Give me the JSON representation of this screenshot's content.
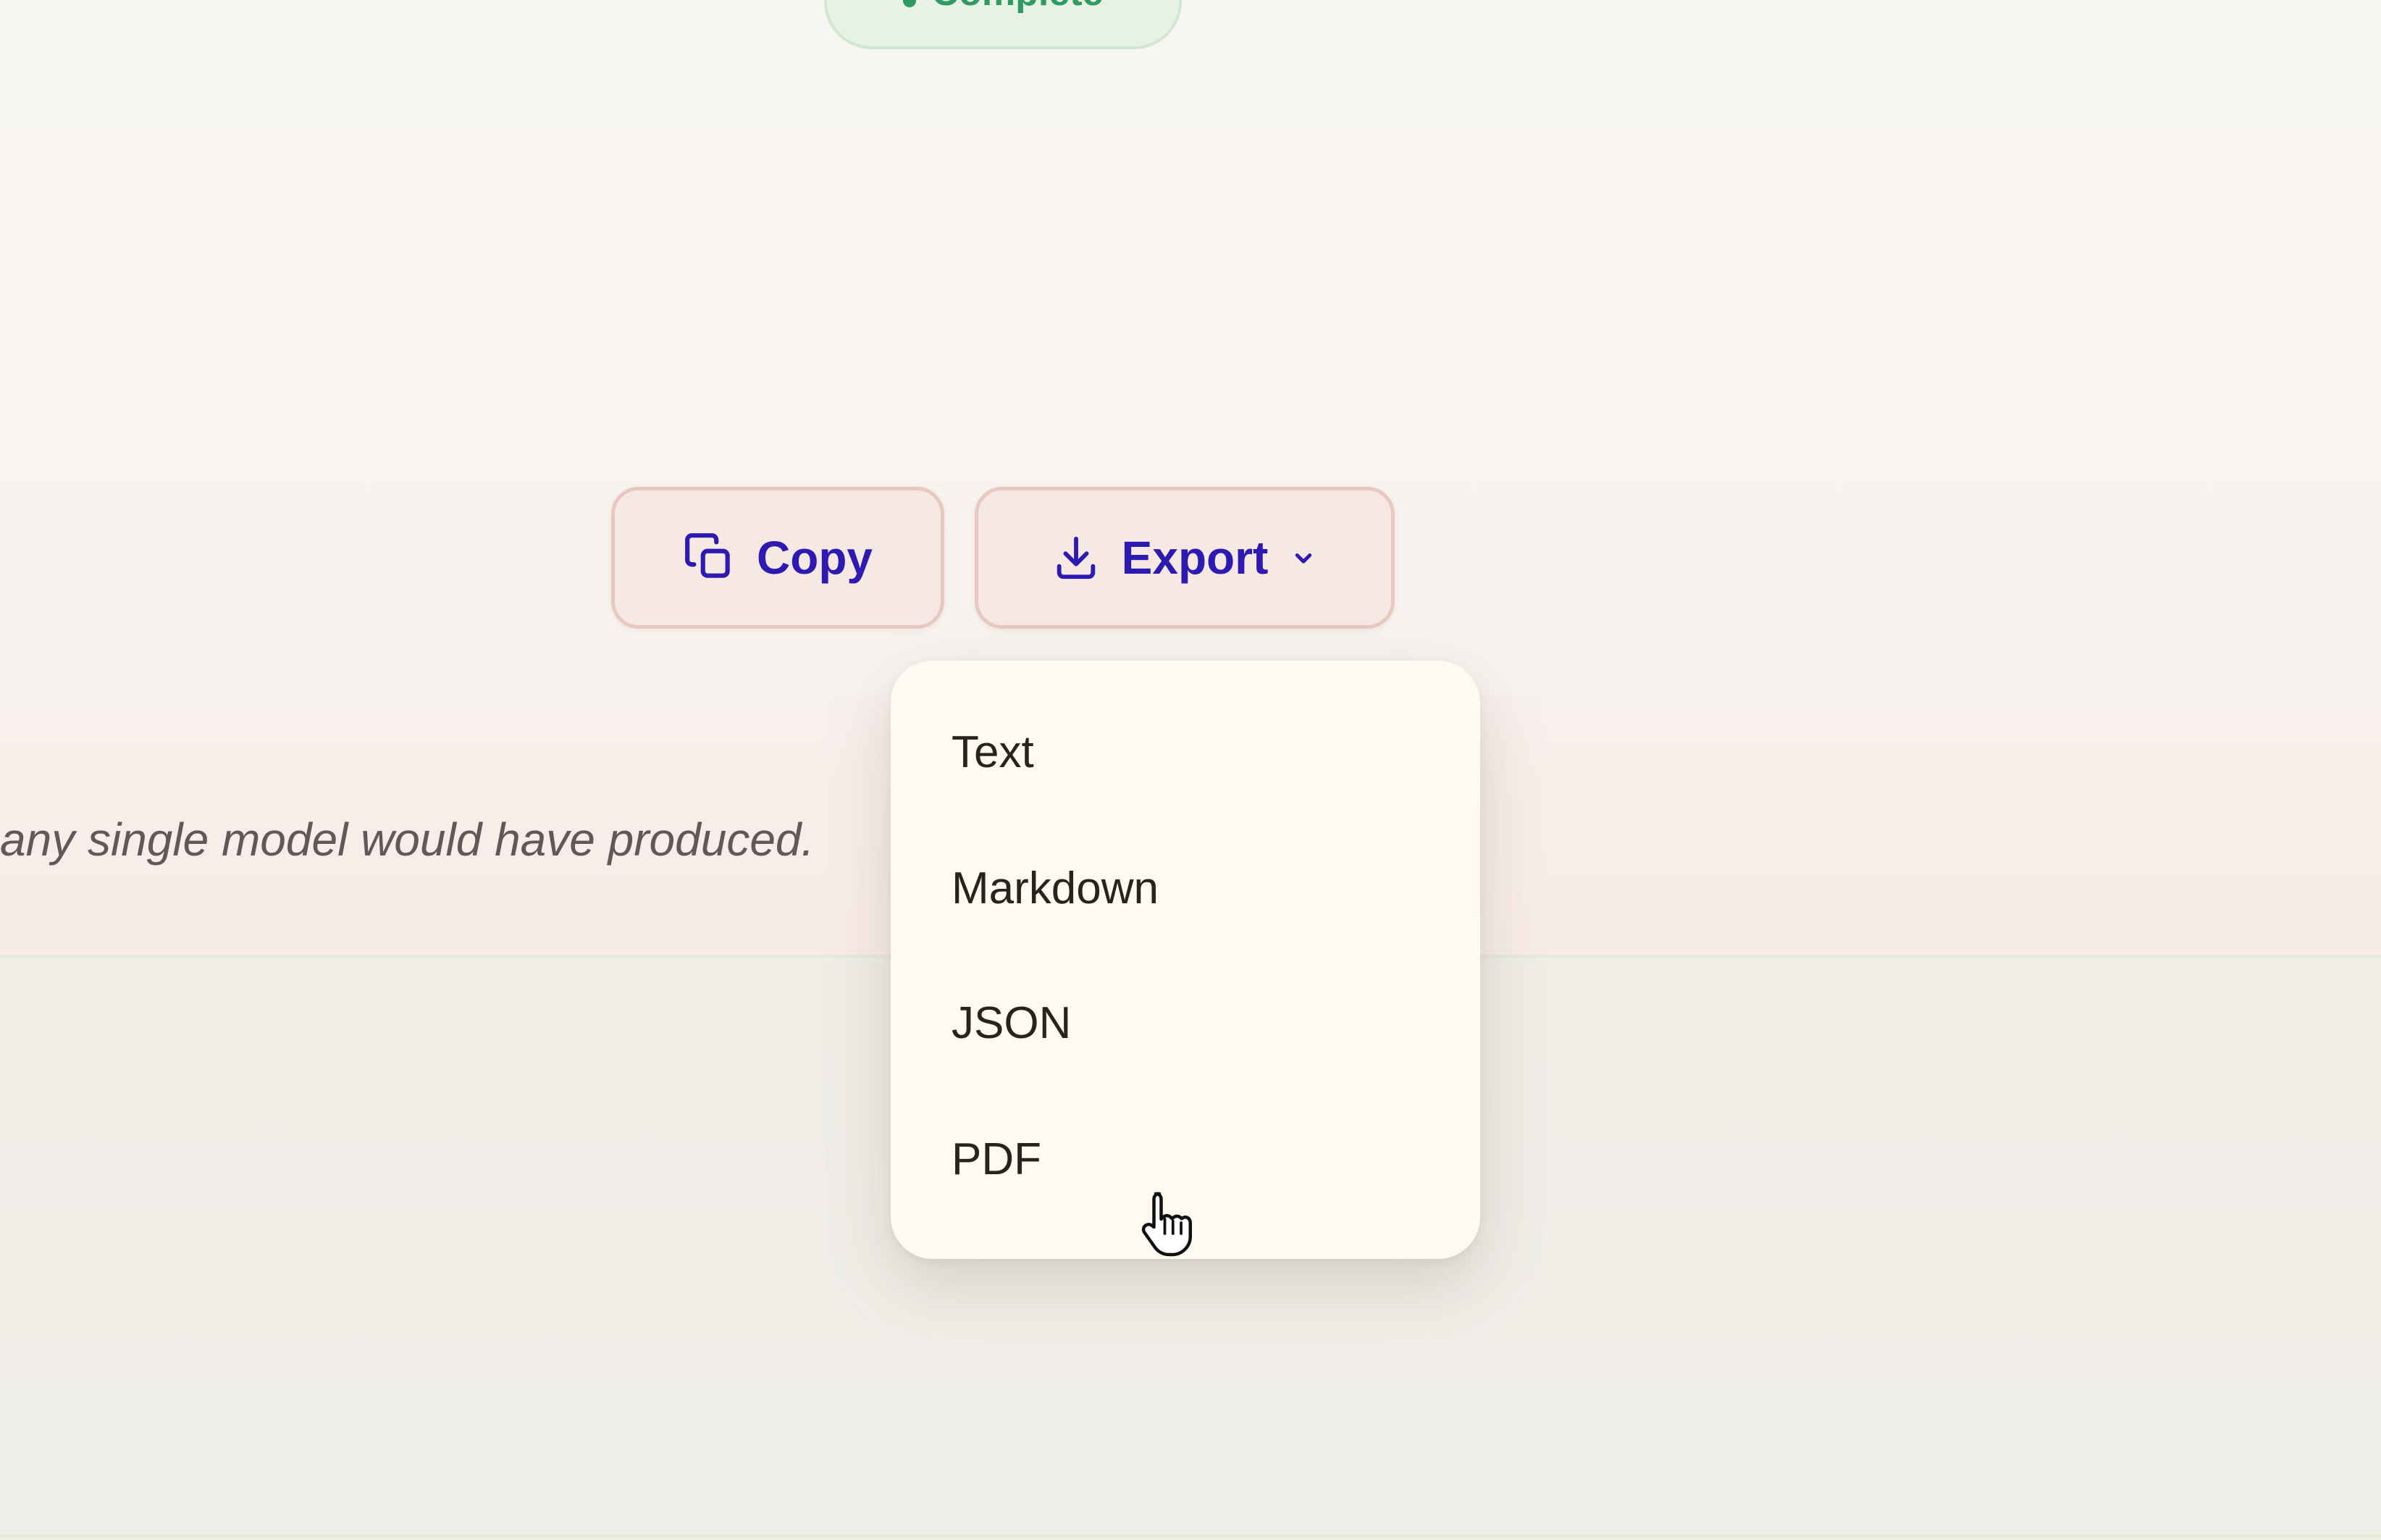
{
  "status": {
    "label": "Complete",
    "color": "#2f9a62"
  },
  "actions": {
    "copy_label": "Copy",
    "export_label": "Export",
    "accent_color": "#2d1ab3"
  },
  "note": {
    "text": "any single model would have produced."
  },
  "export_menu": {
    "items": [
      "Text",
      "Markdown",
      "JSON",
      "PDF"
    ]
  },
  "icons": {
    "copy": "copy-icon",
    "download": "download-icon",
    "chevron": "chevron-down-icon",
    "cursor": "pointer-hand-icon"
  }
}
